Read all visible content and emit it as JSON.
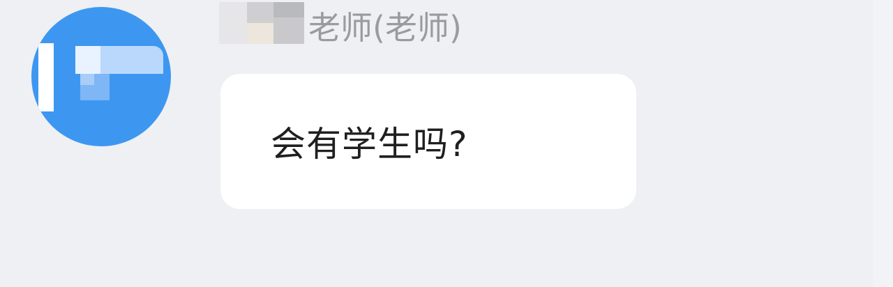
{
  "message": {
    "sender": {
      "avatar": "avatar-logo-icon",
      "name": "老师(老师)"
    },
    "text": "会有学生吗?"
  },
  "colors": {
    "background": "#eef0f4",
    "avatar": "#3d97f1",
    "bubble": "#ffffff",
    "sender_name": "#9a9aa0",
    "message_text": "#1f1f1f"
  }
}
